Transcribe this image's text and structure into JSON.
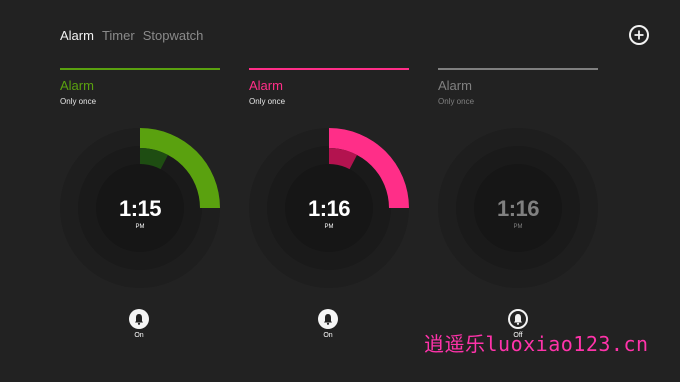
{
  "nav": {
    "tabs": [
      {
        "label": "Alarm",
        "active": true
      },
      {
        "label": "Timer",
        "active": false
      },
      {
        "label": "Stopwatch",
        "active": false
      }
    ]
  },
  "add_button": {
    "icon": "plus-icon"
  },
  "colors": {
    "background": "#222222",
    "green": "#5aa10f",
    "green_dark": "#1e4d12",
    "pink": "#ff2e88",
    "pink_dark": "#b3134f",
    "gray": "#808080"
  },
  "alarms": [
    {
      "title": "Alarm",
      "subtitle": "Only once",
      "time": "1:15",
      "period": "PM",
      "toggle_label": "On",
      "toggle_icon": "bell-icon",
      "state": "on"
    },
    {
      "title": "Alarm",
      "subtitle": "Only once",
      "time": "1:16",
      "period": "PM",
      "toggle_label": "On",
      "toggle_icon": "bell-icon",
      "state": "on"
    },
    {
      "title": "Alarm",
      "subtitle": "Only once",
      "time": "1:16",
      "period": "PM",
      "toggle_label": "Off",
      "toggle_icon": "bell-icon",
      "state": "off"
    }
  ],
  "watermark": "逍遥乐luoxiao123.cn"
}
